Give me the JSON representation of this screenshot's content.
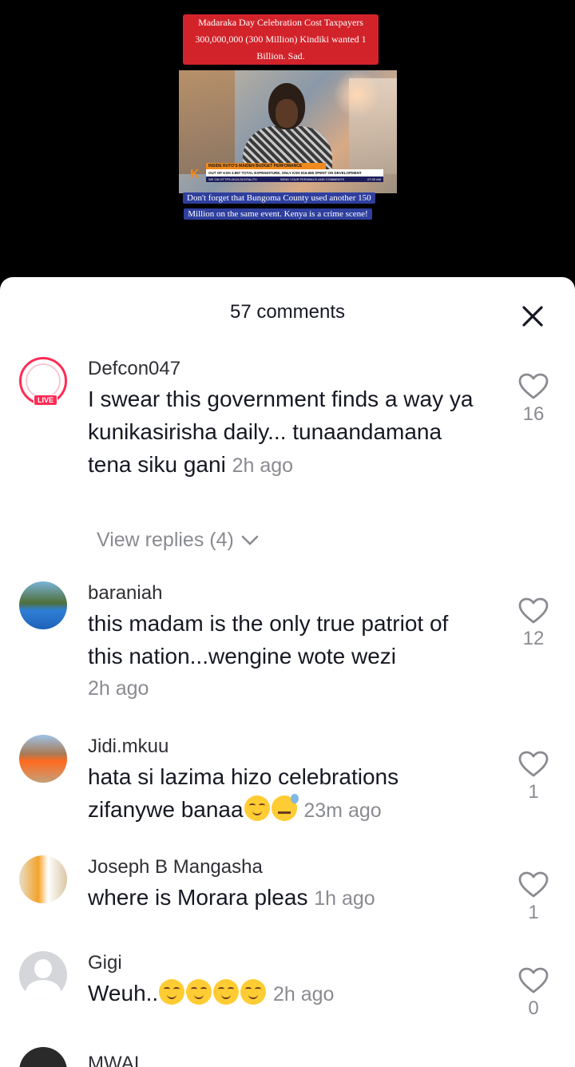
{
  "video": {
    "caption_top": "Madaraka Day Celebration Cost Taxpayers 300,000,000 (300 Million) Kindiki wanted 1 Billion. Sad.",
    "caption_bottom": "Don't forget that Bungoma County used another 150 Million on the same event. Kenya is a crime scene!",
    "news_headline": "INSIDE RUTO'S MAIDEN BUDGET PERFOMANCE",
    "news_subline": "OUT OF KSH 3.897 TOTAL EXPENDITURE, ONLY KSH 516.868 SPENT ON DEVELOPMENT",
    "ticker_left": "WE ON HTTPS://K24.DIGITAL/TV",
    "ticker_mid": "SEND YOUR FEEDBACK AND COMMENTS",
    "ticker_time": "07:09 AM",
    "channel_logo": "K"
  },
  "comments_sheet": {
    "title": "57 comments",
    "close_icon": "close-icon",
    "comments": [
      {
        "username": "Defcon047",
        "text": "I swear this government finds a way ya kunikasirisha daily... tunaandamana tena siku gani",
        "time": "2h ago",
        "likes": "16",
        "live_badge": "LIVE",
        "view_replies": "View replies (4)"
      },
      {
        "username": "baraniah",
        "text": "this madam is the only true patriot of this nation...wengine wote wezi",
        "time": "2h ago",
        "likes": "12"
      },
      {
        "username": "Jidi.mkuu",
        "text": "hata si lazima hizo celebrations zifanywe banaa",
        "time": "23m ago",
        "likes": "1"
      },
      {
        "username": "Joseph B Mangasha",
        "text": "where is Morara pleas",
        "time": "1h ago",
        "likes": "1"
      },
      {
        "username": "Gigi",
        "text": "Weuh..",
        "time": "2h ago",
        "likes": "0"
      },
      {
        "username": "MWAI"
      }
    ]
  },
  "colors": {
    "caption_top_bg": "#d2232a",
    "caption_bottom_bg": "#2e3f9e",
    "live_accent": "#fe2c55",
    "secondary_text": "#8a8b91"
  }
}
